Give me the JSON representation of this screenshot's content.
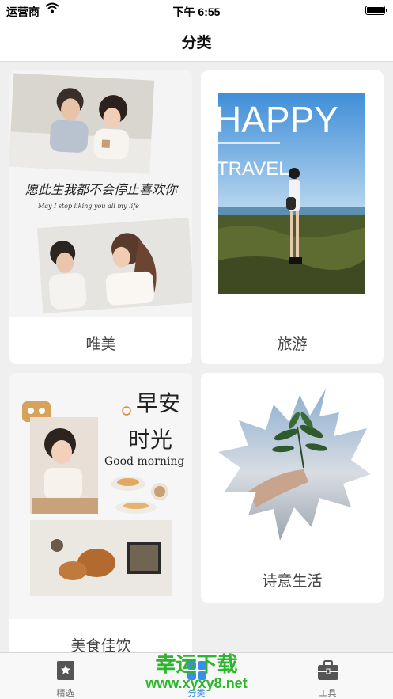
{
  "status_bar": {
    "carrier": "运营商",
    "time": "下午 6:55"
  },
  "nav": {
    "title": "分类"
  },
  "cards": [
    {
      "label": "唯美",
      "image_calligraphy": "愿此生我都不会停止喜欢你",
      "image_caption": "May I stop liking you all my life"
    },
    {
      "label": "旅游",
      "image_text_1": "HAPPY",
      "image_text_2": "TRAVEL"
    },
    {
      "label": "美食佳饮",
      "image_text_1": "早安",
      "image_text_2": "时光",
      "image_text_3": "Good morning"
    },
    {
      "label": "诗意生活"
    }
  ],
  "tabs": [
    {
      "label": "精选",
      "icon": "bookmark-star-icon"
    },
    {
      "label": "分类",
      "icon": "grid-icon"
    },
    {
      "label": "工具",
      "icon": "toolbox-icon"
    }
  ],
  "watermark": {
    "line1": "幸运下载",
    "line2": "www.xyxy8.net"
  },
  "colors": {
    "active_tab": "#3a8ee6",
    "watermark": "#2db52d",
    "background": "#efefef"
  }
}
